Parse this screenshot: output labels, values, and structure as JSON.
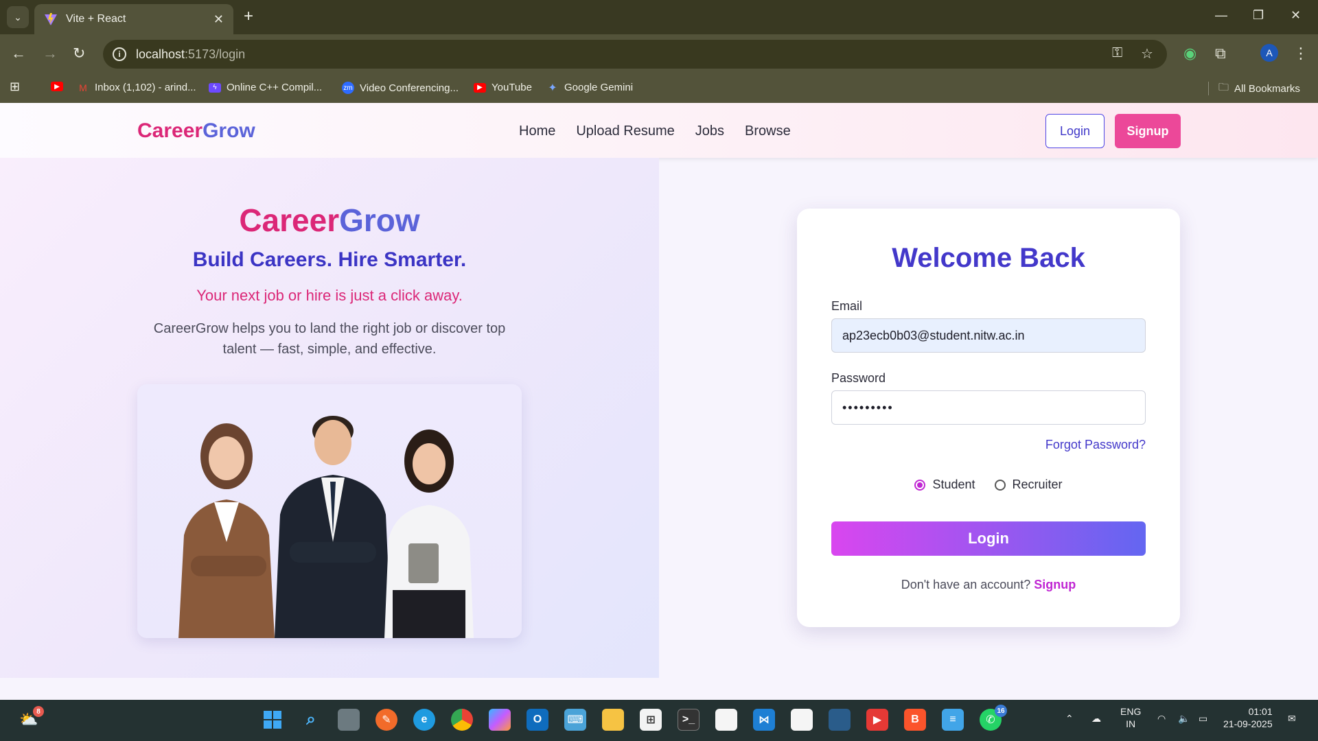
{
  "browser": {
    "tab_title": "Vite + React",
    "url_host": "localhost",
    "url_rest": ":5173/login",
    "bookmarks": [
      {
        "label": "",
        "icon": "youtube-icon"
      },
      {
        "label": "Inbox (1,102) - arind...",
        "icon": "gmail-icon"
      },
      {
        "label": "Online C++ Compil...",
        "icon": "bolt-icon"
      },
      {
        "label": "Video Conferencing...",
        "icon": "zoom-icon"
      },
      {
        "label": "YouTube",
        "icon": "youtube-icon"
      },
      {
        "label": "Google Gemini",
        "icon": "gemini-icon"
      }
    ],
    "all_bookmarks": "All Bookmarks",
    "profile_initial": "A"
  },
  "nav": {
    "brand_part1": "Career",
    "brand_part2": "Grow",
    "links": [
      "Home",
      "Upload Resume",
      "Jobs",
      "Browse"
    ],
    "login": "Login",
    "signup": "Signup"
  },
  "hero": {
    "title_part1": "Career",
    "title_part2": "Grow",
    "subtitle": "Build Careers. Hire Smarter.",
    "tagline": "Your next job or hire is just a click away.",
    "description": "CareerGrow helps you to land the right job or discover top talent — fast, simple, and effective."
  },
  "login_card": {
    "title": "Welcome Back",
    "email_label": "Email",
    "email_value": "ap23ecb0b03@student.nitw.ac.in",
    "password_label": "Password",
    "password_value": "•••••••••",
    "forgot": "Forgot Password?",
    "role_student": "Student",
    "role_recruiter": "Recruiter",
    "selected_role": "Student",
    "submit": "Login",
    "footer_text": "Don't have an account?",
    "footer_link": "Signup"
  },
  "taskbar": {
    "weather_badge": "8",
    "whatsapp_badge": "16",
    "lang_top": "ENG",
    "lang_bottom": "IN",
    "time": "01:01",
    "date": "21-09-2025"
  },
  "colors": {
    "brand_pink": "#db2777",
    "brand_blue": "#5b63d9",
    "accent_indigo": "#4338ca",
    "signup_pink": "#ec4899"
  }
}
